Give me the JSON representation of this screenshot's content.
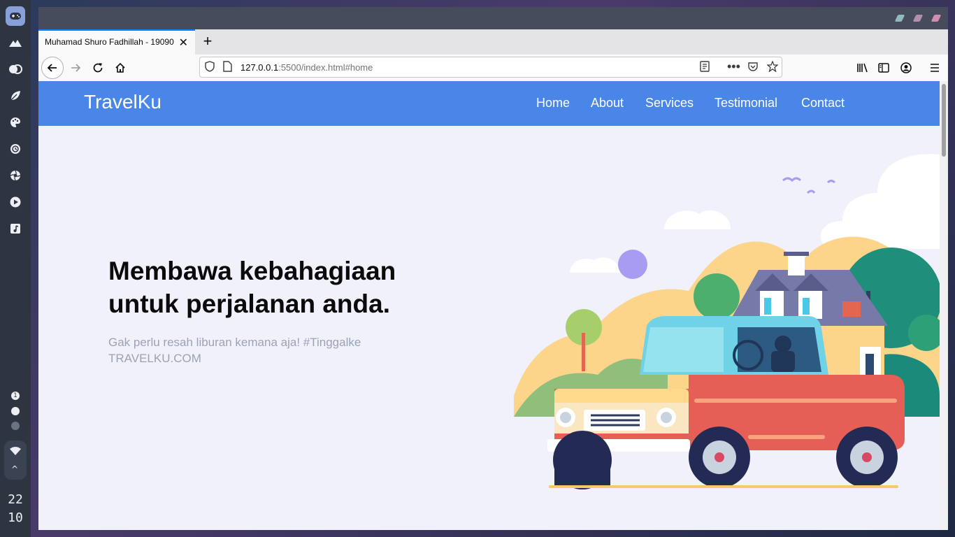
{
  "dock": {
    "workspaces": [
      "1"
    ],
    "clock": {
      "hour": "22",
      "minute": "10"
    }
  },
  "browser": {
    "tab": {
      "title": "Muhamad Shuro Fadhillah - 19090"
    },
    "url": {
      "host": "127.0.0.1",
      "rest": ":5500/index.html#home"
    }
  },
  "site": {
    "brand": "TravelKu",
    "nav": [
      "Home",
      "About",
      "Services",
      "Testimonial",
      "Contact"
    ],
    "hero": {
      "title": "Membawa kebahagiaan untuk perjalanan anda.",
      "subtitle": "Gak perlu resah liburan kemana aja! #Tinggalke TRAVELKU.COM"
    }
  },
  "colors": {
    "header": "#4a86e8",
    "page_bg": "#f1f1fb",
    "accent": "#0a84ff"
  }
}
